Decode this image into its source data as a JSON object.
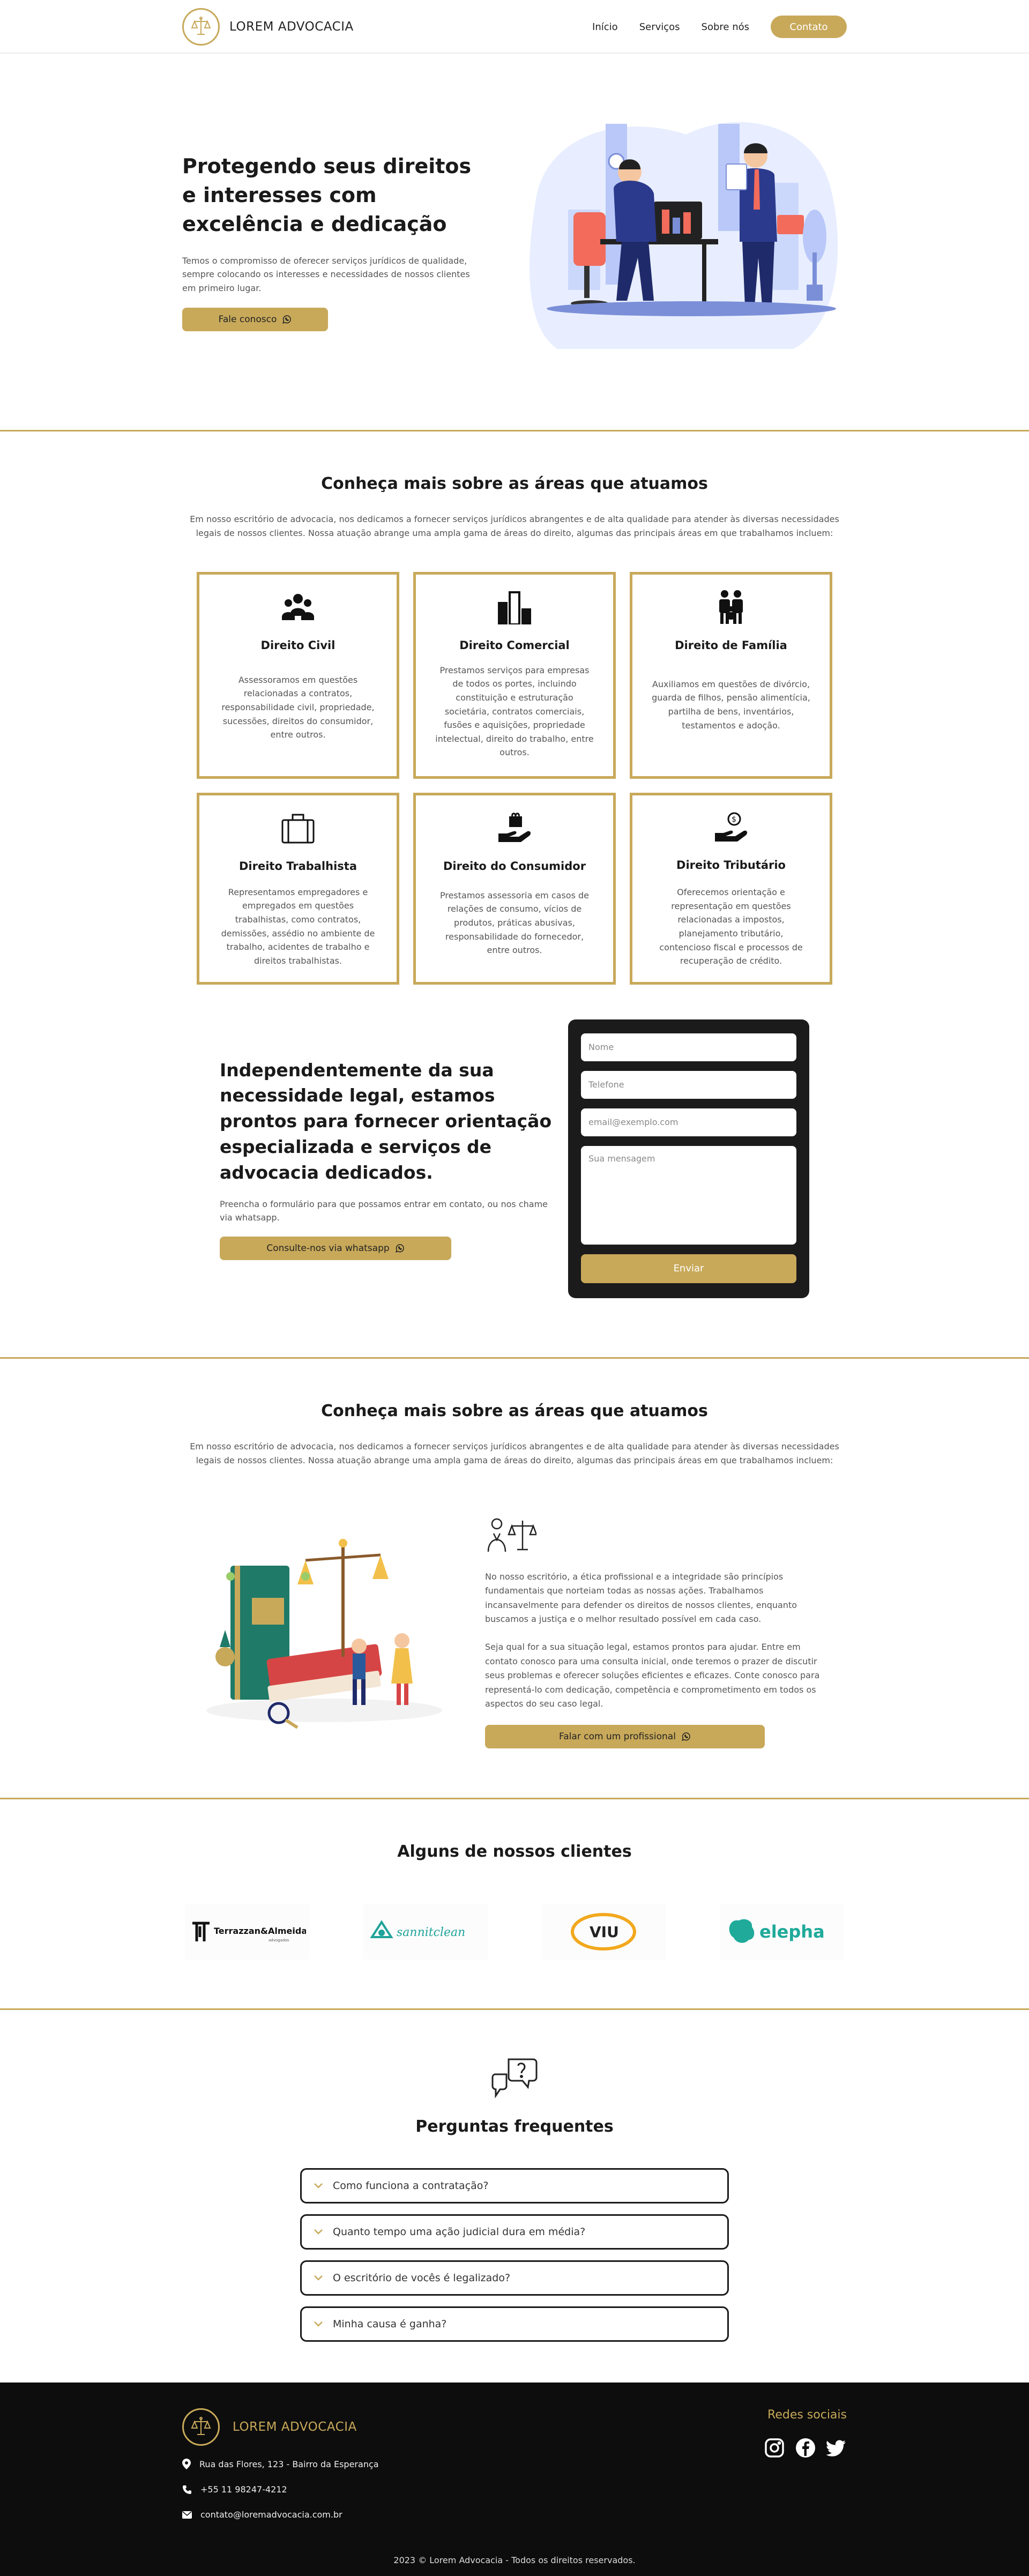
{
  "header": {
    "brand": "LOREM ADVOCACIA",
    "nav": [
      "Início",
      "Serviços",
      "Sobre nós"
    ],
    "cta": "Contato"
  },
  "hero": {
    "title": "Protegendo seus direitos e interesses com excelência e dedicação",
    "text": "Temos o compromisso de oferecer serviços jurídicos de qualidade, sempre colocando os interesses e necessidades de nossos clientes em primeiro lugar.",
    "button": "Fale conosco"
  },
  "areas": {
    "title": "Conheça mais sobre as áreas que atuamos",
    "subtitle": "Em nosso escritório de advocacia, nos dedicamos a fornecer serviços jurídicos abrangentes e de alta qualidade para atender às diversas necessidades legais de nossos clientes. Nossa atuação abrange uma ampla gama de áreas do direito, algumas das principais áreas em que trabalhamos incluem:",
    "cards": [
      {
        "title": "Direito Civil",
        "text": "Assessoramos em questões relacionadas a contratos, responsabilidade civil, propriedade, sucessões, direitos do consumidor, entre outros.",
        "icon": "people-group-icon"
      },
      {
        "title": "Direito Comercial",
        "text": "Prestamos serviços para empresas de todos os portes, incluindo constituição e estruturação societária, contratos comerciais, fusões e aquisições, propriedade intelectual, direito do trabalho, entre outros.",
        "icon": "buildings-icon"
      },
      {
        "title": "Direito de Família",
        "text": "Auxiliamos em questões de divórcio, guarda de filhos, pensão alimentícia, partilha de bens, inventários, testamentos e adoção.",
        "icon": "family-icon"
      },
      {
        "title": "Direito Trabalhista",
        "text": "Representamos empregadores e empregados em questões trabalhistas, como contratos, demissões, assédio no ambiente de trabalho, acidentes de trabalho e direitos trabalhistas.",
        "icon": "briefcase-icon"
      },
      {
        "title": "Direito do Consumidor",
        "text": "Prestamos assessoria em casos de relações de consumo, vícios de produtos, práticas abusivas, responsabilidade do fornecedor, entre outros.",
        "icon": "hand-box-icon"
      },
      {
        "title": "Direito Tributário",
        "text": "Oferecemos orientação e representação em questões relacionadas a impostos, planejamento tributário, contencioso fiscal e processos de recuperação de crédito.",
        "icon": "hand-coin-icon"
      }
    ]
  },
  "contact": {
    "title": "Independentemente da sua necessidade legal, estamos prontos para fornecer orientação especializada e serviços de advocacia dedicados.",
    "text": "Preencha o formulário para que possamos entrar em contato, ou nos chame via whatsapp.",
    "button": "Consulte-nos via whatsapp",
    "form": {
      "name_placeholder": "Nome",
      "phone_placeholder": "Telefone",
      "email_placeholder": "email@exemplo.com",
      "message_placeholder": "Sua mensagem",
      "submit": "Enviar"
    }
  },
  "about": {
    "title": "Conheça mais sobre as áreas que atuamos",
    "subtitle": "Em nosso escritório de advocacia, nos dedicamos a fornecer serviços jurídicos abrangentes e de alta qualidade para atender às diversas necessidades legais de nossos clientes. Nossa atuação abrange uma ampla gama de áreas do direito, algumas das principais áreas em que trabalhamos incluem:",
    "paragraph1": "No nosso escritório, a ética profissional e a integridade são princípios fundamentais que norteiam todas as nossas ações. Trabalhamos incansavelmente para defender os direitos de nossos clientes, enquanto buscamos a justiça e o melhor resultado possível em cada caso.",
    "paragraph2": "Seja qual for a sua situação legal, estamos prontos para ajudar. Entre em contato conosco para uma consulta inicial, onde teremos o prazer de discutir seus problemas e oferecer soluções eficientes e eficazes. Conte conosco para representá-lo com dedicação, competência e comprometimento em todos os aspectos do seu caso legal.",
    "button": "Falar com um profissional"
  },
  "clients": {
    "title": "Alguns de nossos clientes",
    "logos": [
      "Terrazzan&Almeida",
      "advogados",
      "sannitclean",
      "VIU",
      "elepha"
    ]
  },
  "faq": {
    "title": "Perguntas frequentes",
    "items": [
      "Como funciona a contratação?",
      "Quanto tempo uma ação judicial dura em média?",
      "O escritório de vocês é legalizado?",
      "Minha causa é ganha?"
    ]
  },
  "footer": {
    "brand": "LOREM ADVOCACIA",
    "social_title": "Redes sociais",
    "address": "Rua das Flores, 123 - Bairro da Esperança",
    "phone": "+55 11 98247-4212",
    "email": "contato@loremadvocacia.com.br",
    "copyright": "2023 © Lorem Advocacia - Todos os direitos reservados."
  },
  "colors": {
    "accent": "#c8a95a",
    "dark": "#0d0d0d"
  }
}
